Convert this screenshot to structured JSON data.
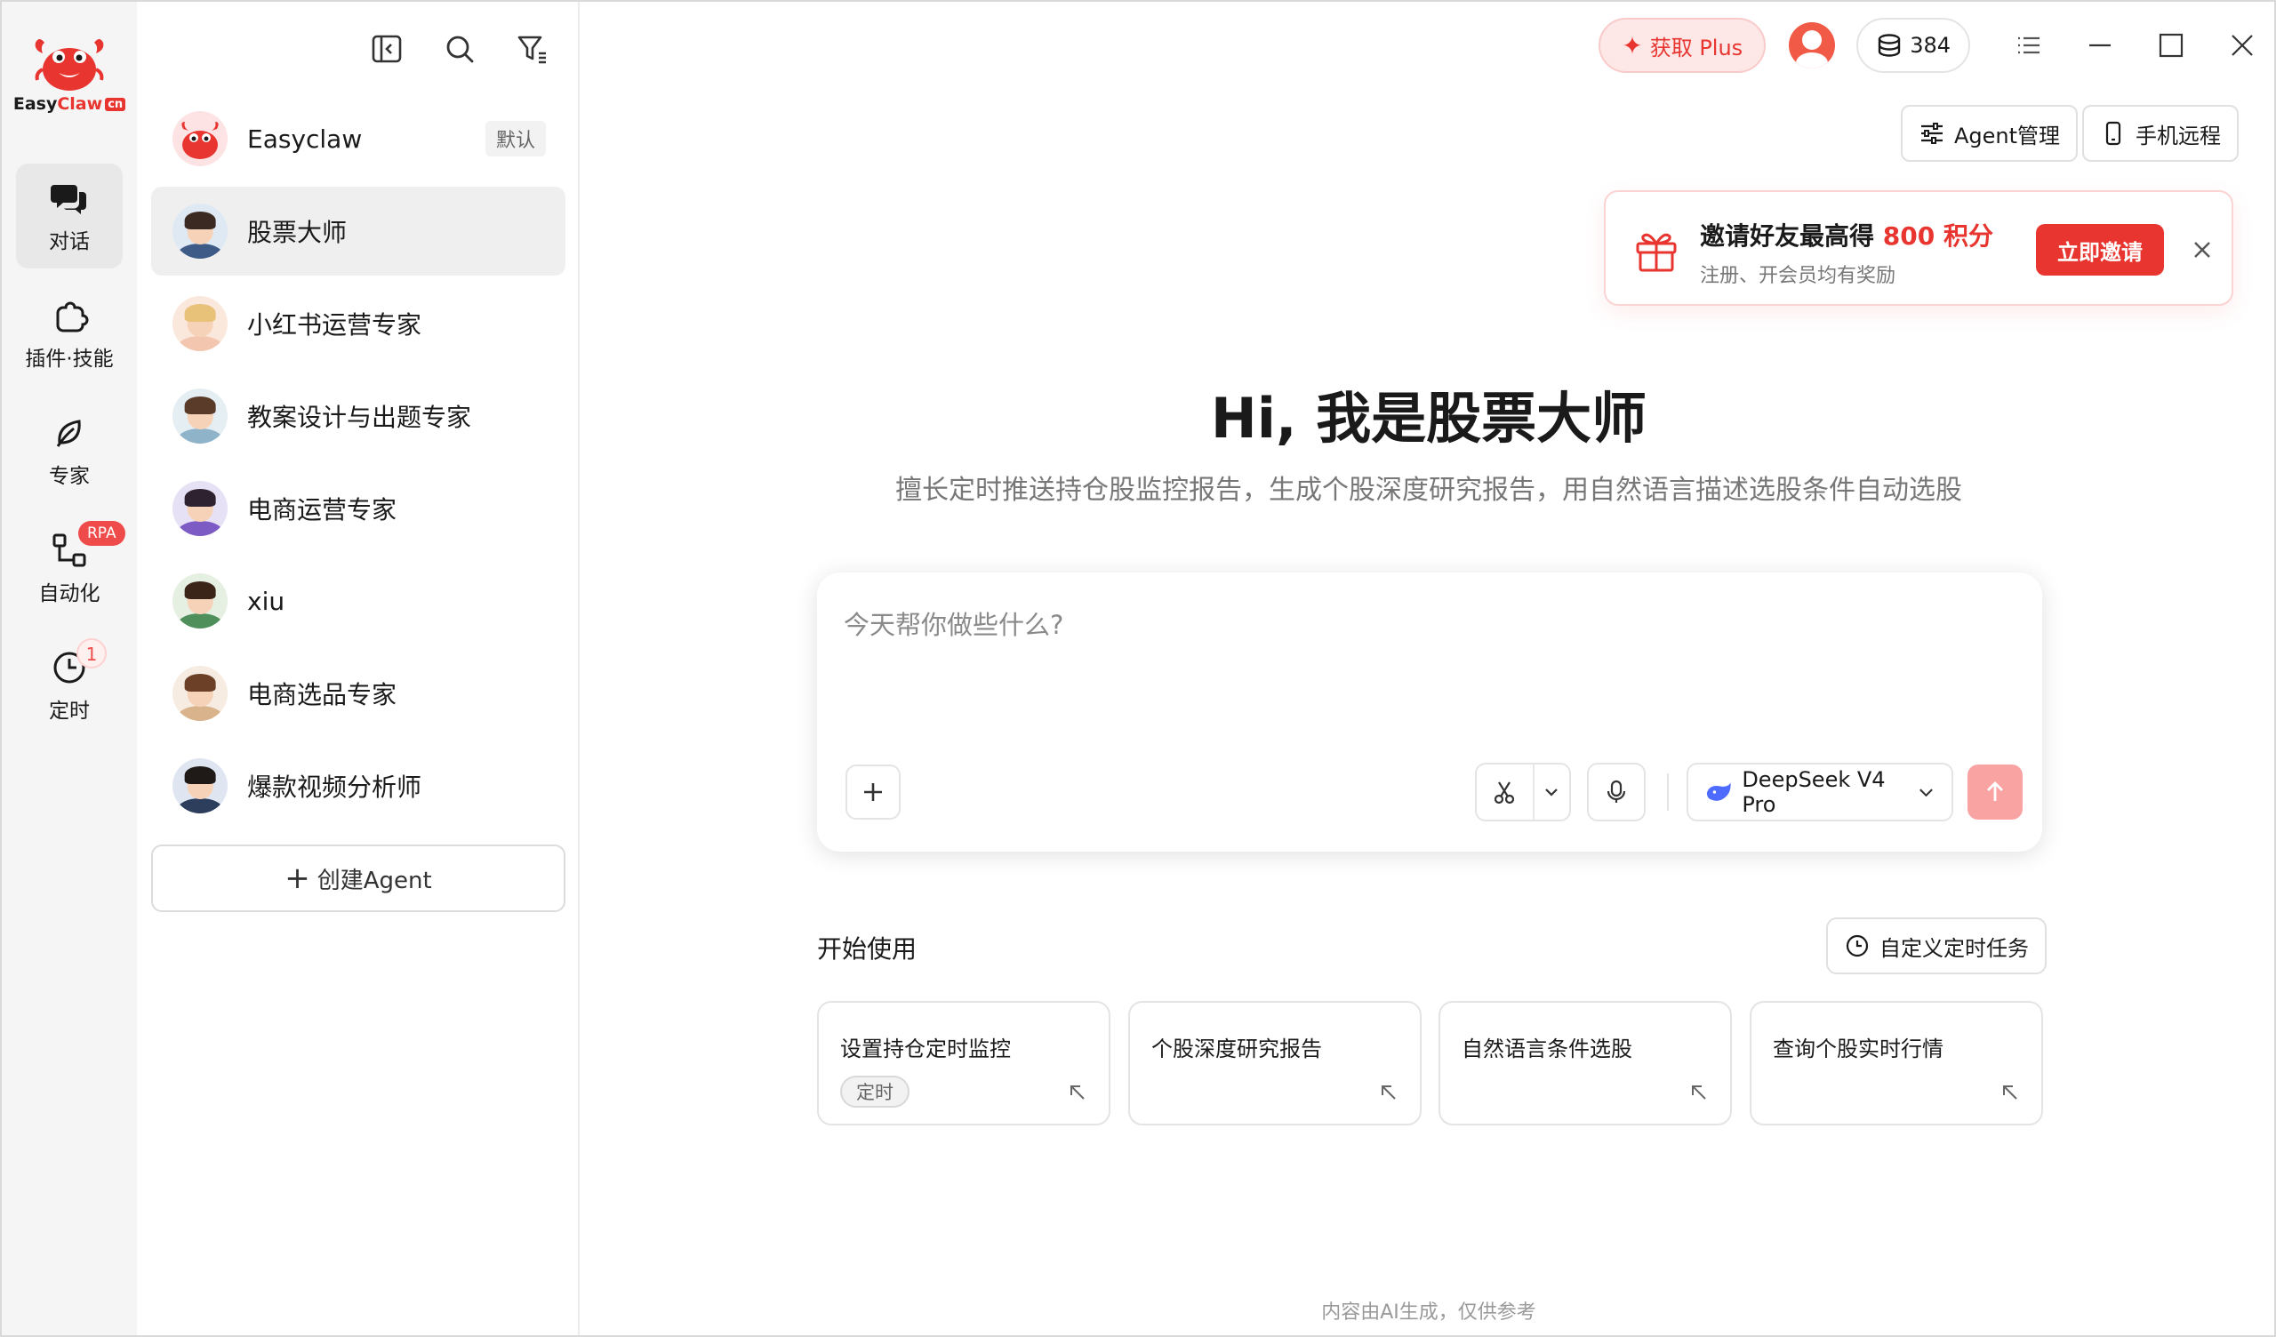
{
  "app": {
    "logo": {
      "text_main": "Easy",
      "text_accent": "Claw",
      "badge": "cn"
    }
  },
  "rail": {
    "items": [
      {
        "label": "对话",
        "icon": "chat-icon",
        "active": true
      },
      {
        "label": "插件·技能",
        "icon": "puzzle-icon",
        "active": false
      },
      {
        "label": "专家",
        "icon": "leaf-icon",
        "active": false
      },
      {
        "label": "自动化",
        "icon": "flow-icon",
        "badge": "RPA",
        "active": false
      },
      {
        "label": "定时",
        "icon": "clock-icon",
        "badge": "1",
        "active": false
      }
    ]
  },
  "panel": {
    "tools": [
      "collapse-sidebar-icon",
      "search-icon",
      "filter-icon"
    ],
    "agents": [
      {
        "name": "Easyclaw",
        "tag": "默认"
      },
      {
        "name": "股票大师",
        "active": true
      },
      {
        "name": "小红书运营专家"
      },
      {
        "name": "教案设计与出题专家"
      },
      {
        "name": "电商运营专家"
      },
      {
        "name": "xiu"
      },
      {
        "name": "电商选品专家"
      },
      {
        "name": "爆款视频分析师"
      }
    ],
    "create_label": "创建Agent"
  },
  "topbar": {
    "plus_label": "获取 Plus",
    "credits": "384"
  },
  "actions": {
    "agent_manage": "Agent管理",
    "mobile_remote": "手机远程"
  },
  "invite": {
    "title_prefix": "邀请好友最高得 ",
    "title_points": "800 积分",
    "subtitle": "注册、开会员均有奖励",
    "button": "立即邀请"
  },
  "hero": {
    "title": "Hi, 我是股票大师",
    "subtitle": "擅长定时推送持仓股监控报告，生成个股深度研究报告，用自然语言描述选股条件自动选股"
  },
  "composer": {
    "placeholder": "今天帮你做些什么?",
    "model": "DeepSeek V4 Pro"
  },
  "start": {
    "label": "开始使用",
    "custom_task": "自定义定时任务",
    "cards": [
      {
        "title": "设置持仓定时监控",
        "tag": "定时"
      },
      {
        "title": "个股深度研究报告"
      },
      {
        "title": "自然语言条件选股"
      },
      {
        "title": "查询个股实时行情"
      }
    ]
  },
  "footer": {
    "note": "内容由AI生成，仅供参考"
  },
  "colors": {
    "accent": "#e8352f",
    "send_disabled": "#f9a3a3",
    "rail_bg": "#f5f5f5"
  }
}
